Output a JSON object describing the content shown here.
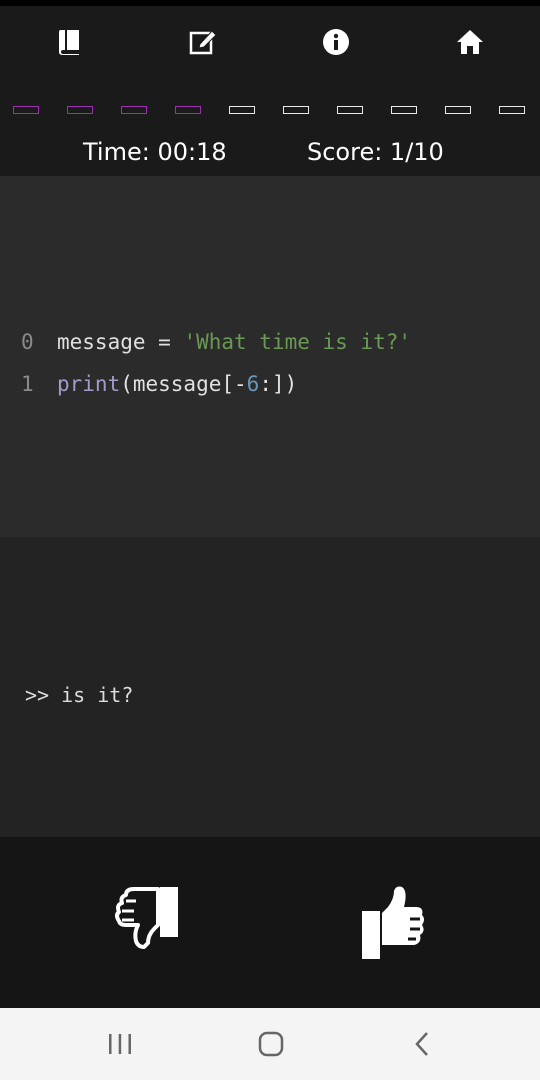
{
  "toolbar": {
    "icons": [
      "book-icon",
      "edit-icon",
      "info-icon",
      "home-icon"
    ]
  },
  "progress": {
    "total": 10,
    "completed": 4,
    "completed_color": "#9b2fae",
    "remaining_color": "#e8e8e8"
  },
  "stats": {
    "time": "Time: 00:18",
    "score": "Score: 1/10"
  },
  "code": {
    "lines": [
      {
        "number": "0",
        "tokens": [
          {
            "text": "message = ",
            "color": "#e0e0e0"
          },
          {
            "text": "'What time is it?'",
            "color": "#6a9955"
          }
        ]
      },
      {
        "number": "1",
        "tokens": [
          {
            "text": "print",
            "color": "#a29bc9"
          },
          {
            "text": "(message[-",
            "color": "#e0e0e0"
          },
          {
            "text": "6",
            "color": "#6897bb"
          },
          {
            "text": ":])",
            "color": "#e0e0e0"
          }
        ]
      }
    ]
  },
  "output": {
    "text": ">> is it?"
  },
  "answer": {
    "buttons": [
      "thumbs-down",
      "thumbs-up"
    ]
  },
  "system_nav": {
    "buttons": [
      "recent-apps",
      "home",
      "back"
    ]
  },
  "colors": {
    "topbar": "#1a1a1a",
    "code_bg": "#2b2b2b",
    "output_bg": "#232323",
    "answer_bg": "#151515",
    "navbar_bg": "#f4f4f4"
  }
}
